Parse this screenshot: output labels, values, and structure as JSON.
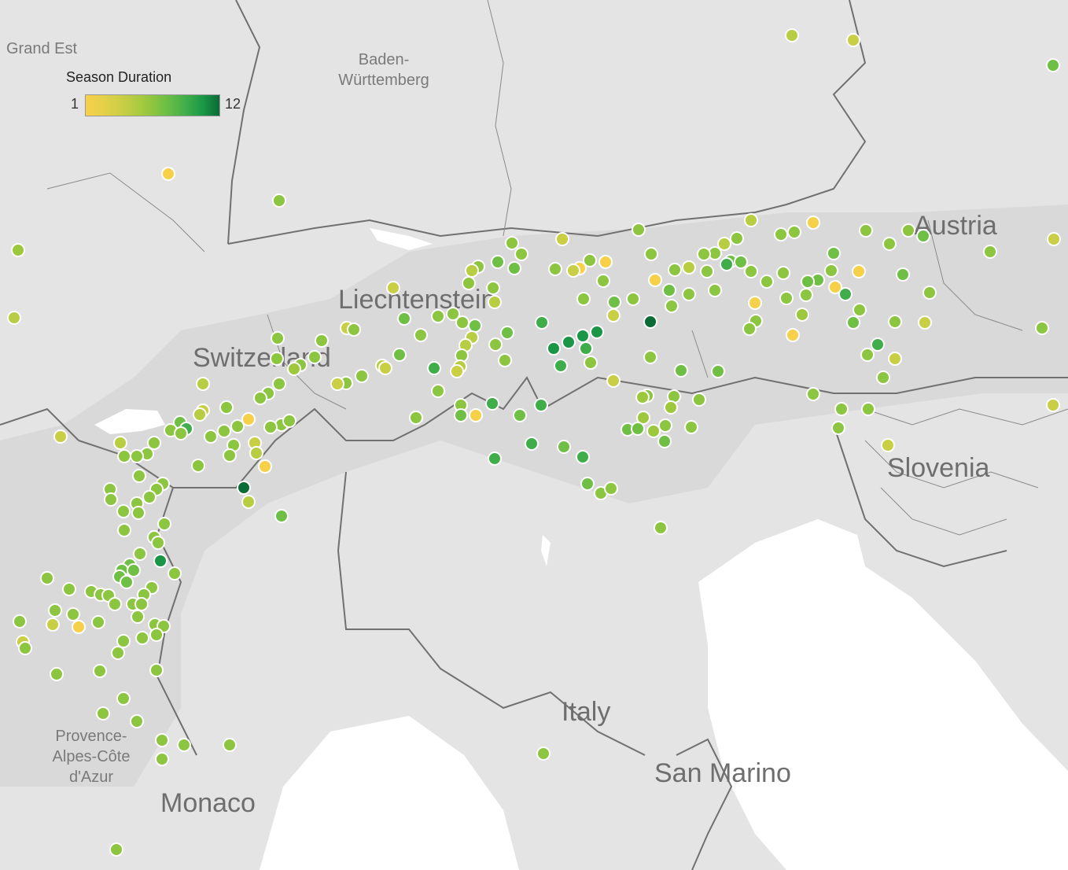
{
  "legend": {
    "title": "Season Duration",
    "min_label": "1",
    "max_label": "12",
    "colors": [
      "#f7d04a",
      "#e8d04a",
      "#c8cf45",
      "#9dc83e",
      "#6fbf45",
      "#3fae4a",
      "#1a9646",
      "#0b6b36"
    ]
  },
  "labels": {
    "grand_est": "Grand Est",
    "baden_1": "Baden-",
    "baden_2": "Württemberg",
    "austria": "Austria",
    "liechtenstein": "Liechtenstein",
    "switzerland": "Switzerland",
    "slovenia": "Slovenia",
    "italy": "Italy",
    "san_marino": "San Marino",
    "monaco": "Monaco",
    "paca_1": "Provence-",
    "paca_2": "Alpes-Côte",
    "paca_3": "d'Azur"
  },
  "colors": {
    "land": "#e4e4e4",
    "alps_land": "#dadada",
    "sea": "#ffffff",
    "border": "#707070"
  }
}
